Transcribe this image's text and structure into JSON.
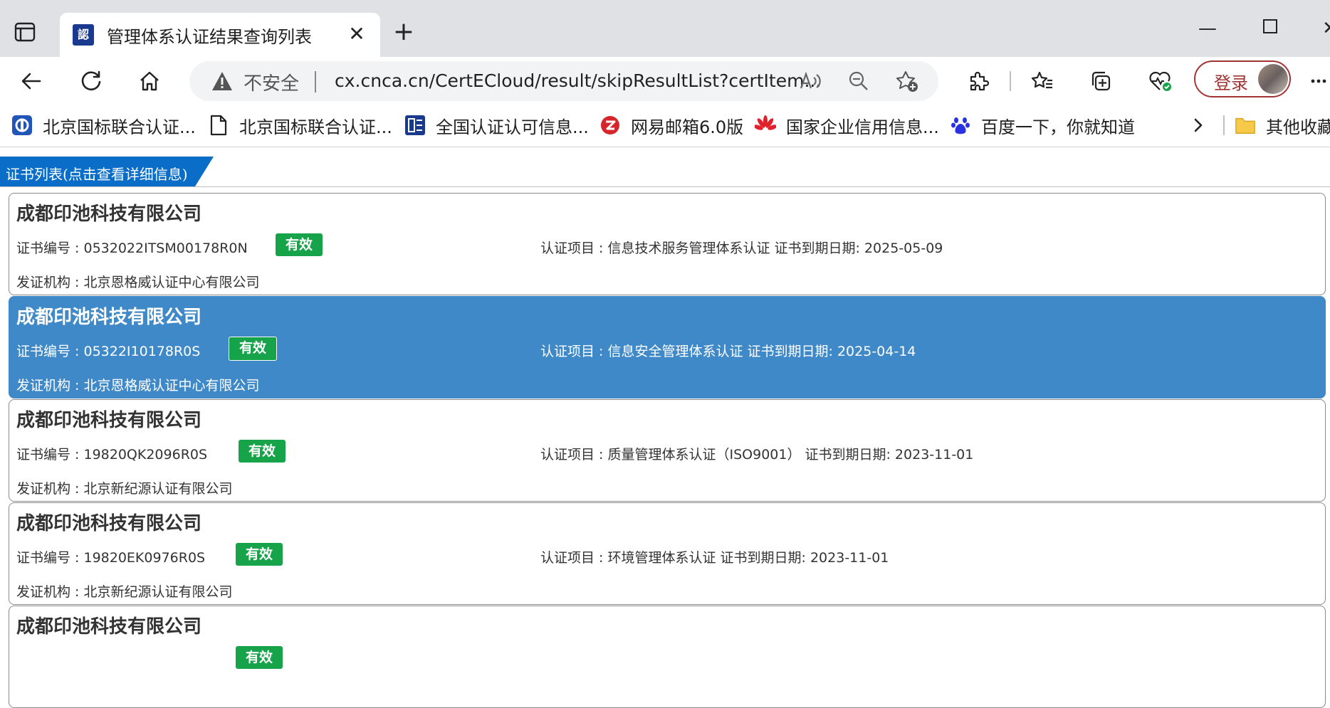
{
  "browser": {
    "tab": {
      "title": "管理体系认证结果查询列表",
      "favicon": "cnca-icon"
    },
    "address_bar": {
      "security_label": "不安全",
      "url": "cx.cnca.cn/CertECloud/result/skipResultList?certItem..."
    },
    "login_label": "登录",
    "bookmarks": [
      {
        "label": "北京国标联合认证...",
        "icon": "bgcert-icon"
      },
      {
        "label": "北京国标联合认证...",
        "icon": "page-icon"
      },
      {
        "label": "全国认证认可信息...",
        "icon": "cnca-icon"
      },
      {
        "label": "网易邮箱6.0版",
        "icon": "netease-icon"
      },
      {
        "label": "国家企业信用信息...",
        "icon": "huawei-icon"
      },
      {
        "label": "百度一下，你就知道",
        "icon": "baidu-paw-icon"
      }
    ],
    "other_bookmarks": "其他收藏"
  },
  "page": {
    "section_title": "证书列表(点击查看详细信息)",
    "records": [
      {
        "company": "成都印池科技有限公司",
        "cert_no": "证书编号 : 0532022ITSM00178R0N",
        "status": "有效",
        "item": "认证项目 : 信息技术服务管理体系认证   证书到期日期: 2025-05-09",
        "issuer": "发证机构 : 北京恩格威认证中心有限公司",
        "selected": false
      },
      {
        "company": "成都印池科技有限公司",
        "cert_no": "证书编号 : 05322I10178R0S",
        "status": "有效",
        "item": "认证项目 : 信息安全管理体系认证   证书到期日期: 2025-04-14",
        "issuer": "发证机构 : 北京恩格威认证中心有限公司",
        "selected": true
      },
      {
        "company": "成都印池科技有限公司",
        "cert_no": "证书编号 : 19820QK2096R0S",
        "status": "有效",
        "item": "认证项目 : 质量管理体系认证（ISO9001）   证书到期日期: 2023-11-01",
        "issuer": "发证机构 : 北京新纪源认证有限公司",
        "selected": false
      },
      {
        "company": "成都印池科技有限公司",
        "cert_no": "证书编号 : 19820EK0976R0S",
        "status": "有效",
        "item": "认证项目 : 环境管理体系认证   证书到期日期: 2023-11-01",
        "issuer": "发证机构 : 北京新纪源认证有限公司",
        "selected": false
      },
      {
        "company": "成都印池科技有限公司",
        "cert_no": "",
        "status": "有效",
        "item": "",
        "issuer": "",
        "selected": false
      }
    ]
  },
  "colors": {
    "accent_blue": "#0a6ec8",
    "selected_row": "#3f89c8",
    "status_green": "#16a34a",
    "login_red": "#a23333"
  }
}
